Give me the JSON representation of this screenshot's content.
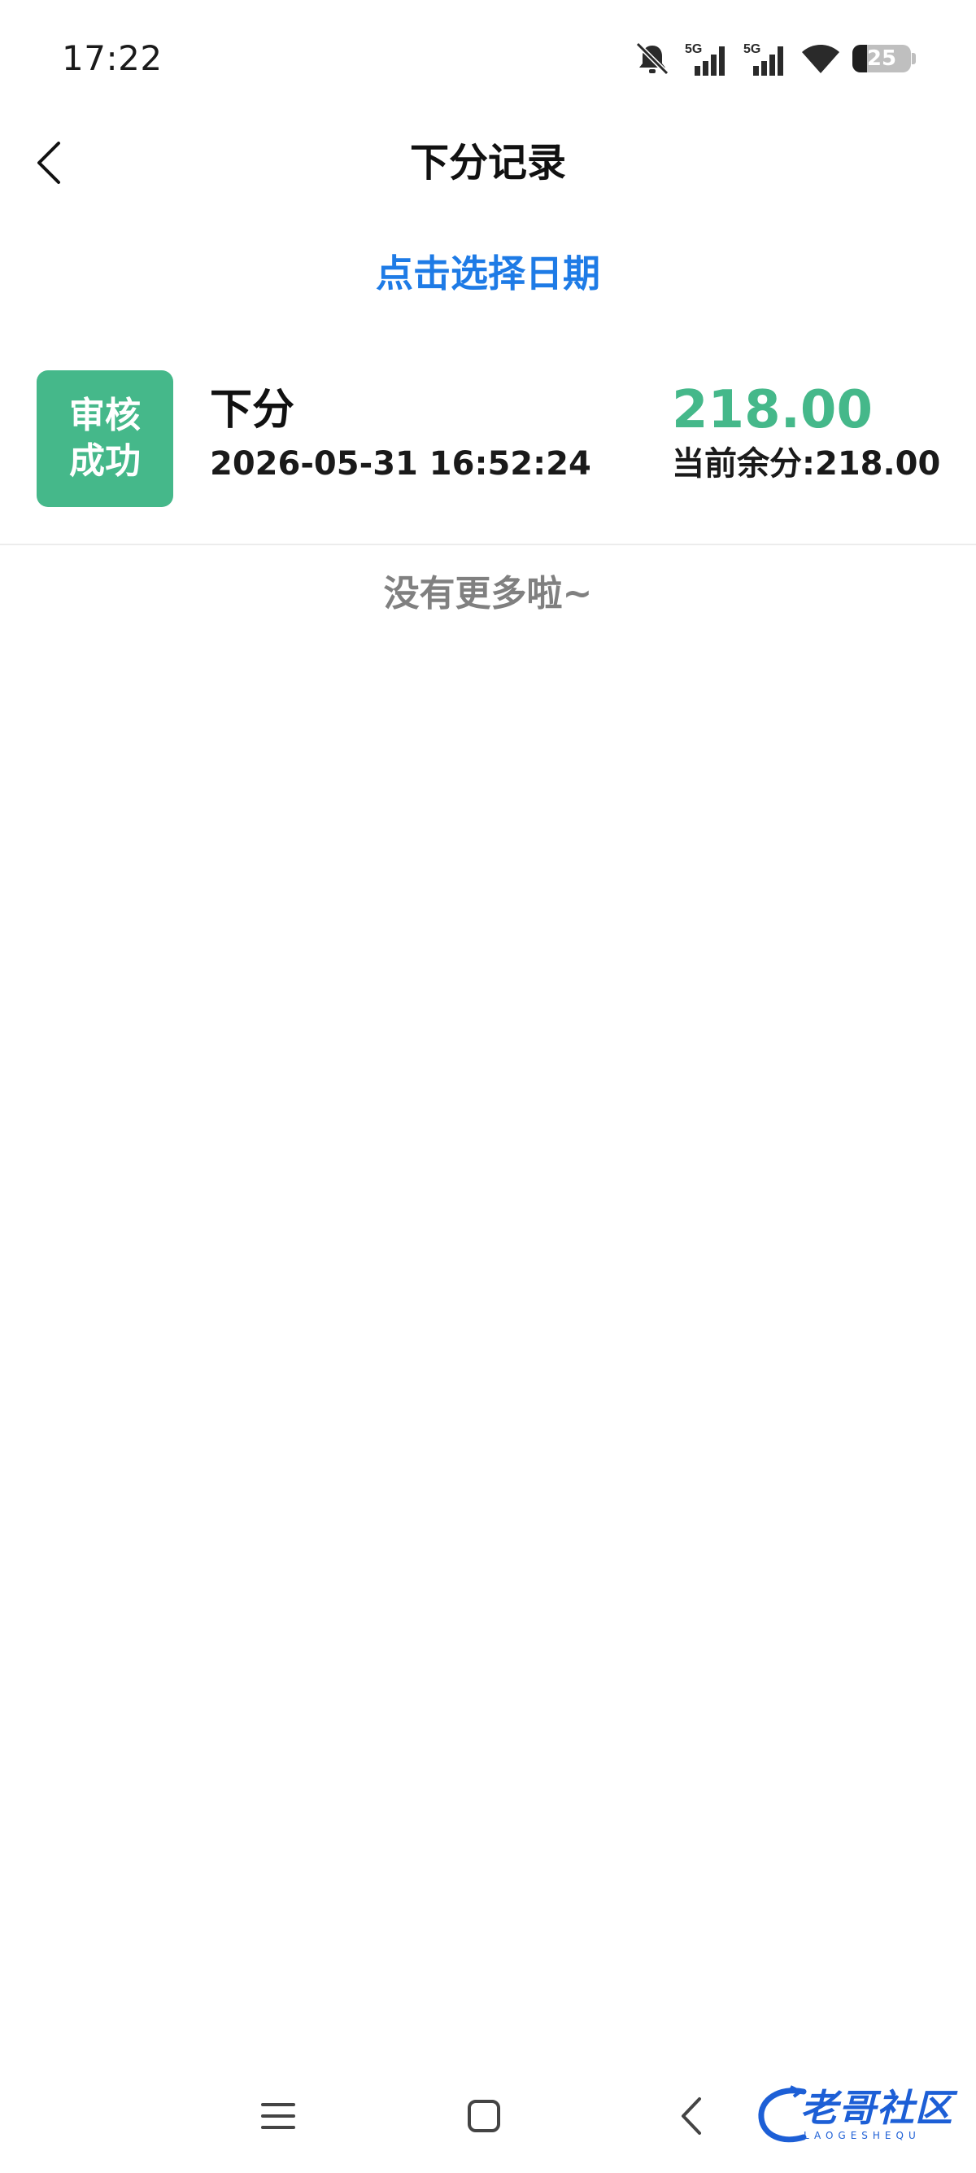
{
  "status_bar": {
    "time": "17:22",
    "network_label_1": "5G",
    "network_label_2": "5G",
    "battery_level": "25",
    "battery_fraction": 0.25,
    "icons": [
      "bell-muted-icon",
      "signal-icon",
      "signal-icon",
      "wifi-icon",
      "battery-icon"
    ]
  },
  "header": {
    "title": "下分记录",
    "back_icon": "chevron-left-icon"
  },
  "date_picker": {
    "label": "点击选择日期",
    "color": "#1e7be6"
  },
  "records": [
    {
      "status": "审核成功",
      "status_line1": "审核",
      "status_line2": "成功",
      "status_color": "#45b88a",
      "type": "下分",
      "datetime": "2026-05-31 16:52:24",
      "amount": "218.00",
      "amount_color": "#45b88a",
      "balance": "当前余分:218.00"
    }
  ],
  "list_footer": "没有更多啦~",
  "nav_bar": {
    "icons": [
      "menu-icon",
      "home-square-icon",
      "back-chevron-icon"
    ]
  },
  "watermark": {
    "text": "老哥社区",
    "subtext": "LAOGESHEQU"
  }
}
